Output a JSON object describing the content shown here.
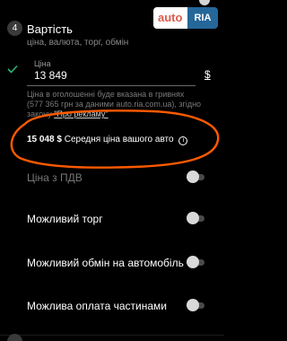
{
  "logo": {
    "left_text": "auto",
    "right_text": "RIA",
    "left_color": "#db5c4c",
    "right_bg": "#256799"
  },
  "section": {
    "step": "4",
    "title": "Вартість",
    "subtitle": "ціна, валюта, торг, обмін"
  },
  "price_field": {
    "label": "Ціна",
    "value": "13 849",
    "currency": "$"
  },
  "note": {
    "line1": "Ціна в оголошенні буде вказана в гривнях",
    "line2": "(577 365 грн за даними auto.ria.com.ua), згідно",
    "line3_prefix": "закону ",
    "line3_link": "\"Про рекламу\""
  },
  "average": {
    "value": "15 048 $",
    "text": "Середня ціна вашого авто",
    "info_icon": "i"
  },
  "options": [
    {
      "label": "Ціна з ПДВ",
      "enabled": false
    },
    {
      "label": "Можливий торг",
      "enabled": true
    },
    {
      "label": "Можливий обмін на автомобіль",
      "enabled": true
    },
    {
      "label": "Можлива оплата частинами",
      "enabled": true
    }
  ],
  "colors": {
    "accent_check": "#2bb673",
    "annotation": "#ff5a00"
  }
}
